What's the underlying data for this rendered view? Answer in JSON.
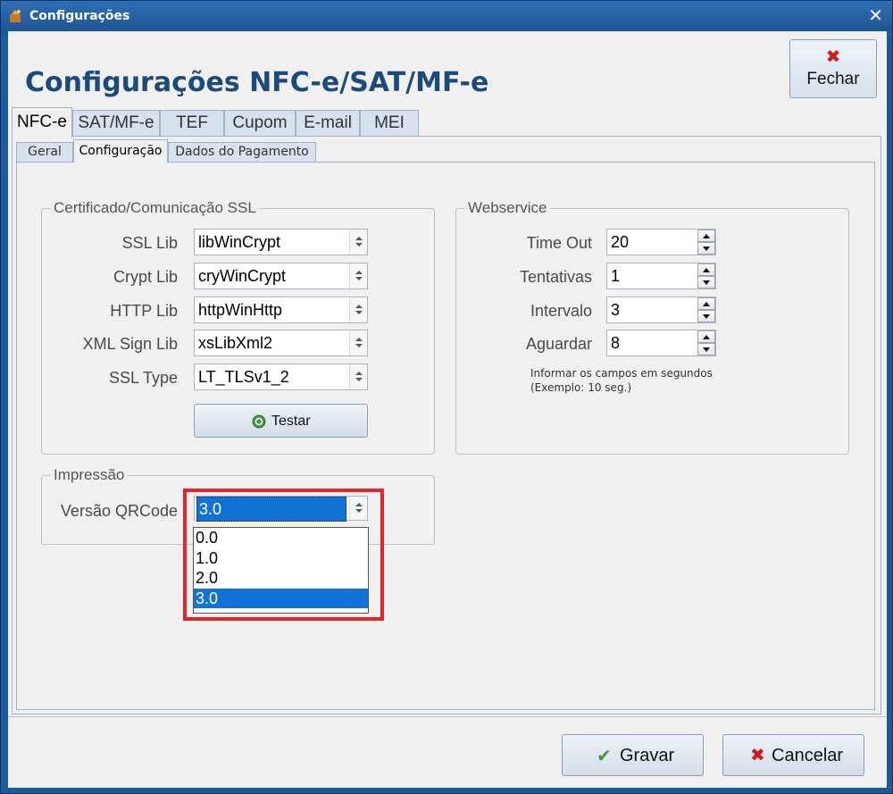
{
  "window": {
    "title": "Configurações"
  },
  "header": {
    "title": "Configurações NFC-e/SAT/MF-e",
    "close_label": "Fechar"
  },
  "main_tabs": [
    {
      "label": "NFC-e",
      "active": true
    },
    {
      "label": "SAT/MF-e"
    },
    {
      "label": "TEF"
    },
    {
      "label": "Cupom"
    },
    {
      "label": "E-mail"
    },
    {
      "label": "MEI"
    }
  ],
  "sub_tabs": [
    {
      "label": "Geral"
    },
    {
      "label": "Configuração",
      "active": true
    },
    {
      "label": "Dados do Pagamento"
    }
  ],
  "certificado": {
    "title": "Certificado/Comunicação SSL",
    "fields": [
      {
        "label": "SSL Lib",
        "value": "libWinCrypt"
      },
      {
        "label": "Crypt Lib",
        "value": "cryWinCrypt"
      },
      {
        "label": "HTTP Lib",
        "value": "httpWinHttp"
      },
      {
        "label": "XML Sign Lib",
        "value": "xsLibXml2"
      },
      {
        "label": "SSL Type",
        "value": "LT_TLSv1_2"
      }
    ],
    "test_button": "Testar"
  },
  "webservice": {
    "title": "Webservice",
    "fields": [
      {
        "label": "Time Out",
        "value": "20"
      },
      {
        "label": "Tentativas",
        "value": "1"
      },
      {
        "label": "Intervalo",
        "value": "3"
      },
      {
        "label": "Aguardar",
        "value": "8"
      }
    ],
    "hint_line1": "Informar os campos em segundos",
    "hint_line2": "(Exemplo: 10 seg.)"
  },
  "impressao": {
    "title": "Impressão",
    "qrcode_label": "Versão QRCode",
    "qrcode_value": "3.0",
    "options": [
      "0.0",
      "1.0",
      "2.0",
      "3.0"
    ],
    "selected_option": "3.0"
  },
  "footer": {
    "save_label": "Gravar",
    "cancel_label": "Cancelar"
  },
  "colors": {
    "accent": "#1d4a7c",
    "selection": "#1173d6",
    "highlight": "#e0262b"
  }
}
